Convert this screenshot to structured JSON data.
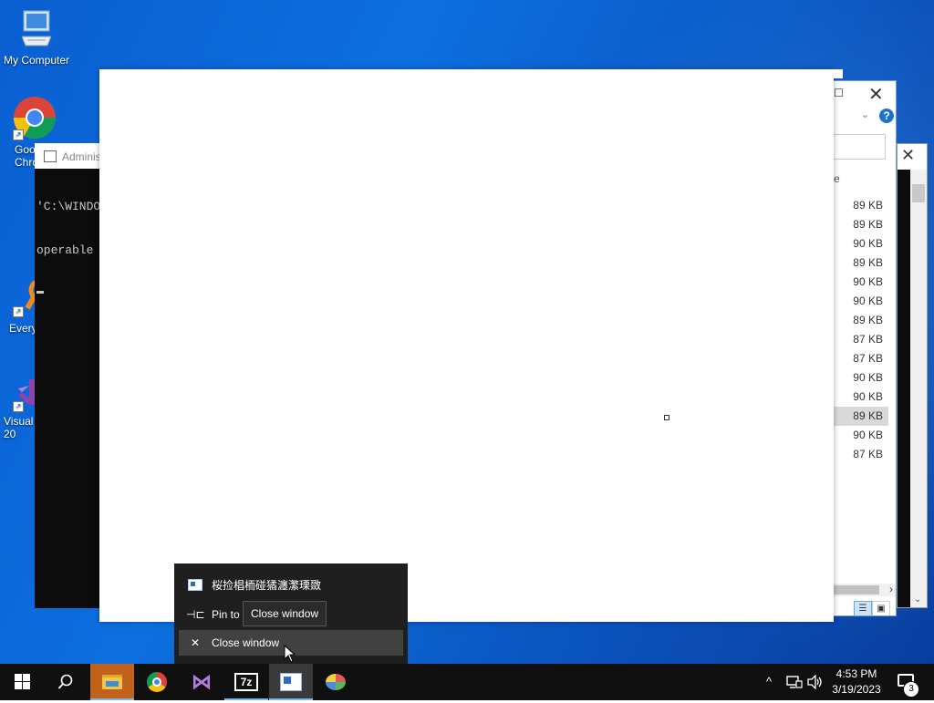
{
  "desktop": {
    "icons": [
      {
        "label": "My Computer",
        "icon": "computer-icon"
      },
      {
        "label": "Goo\nChro",
        "icon": "chrome-icon"
      },
      {
        "label": "Every",
        "icon": "everything-icon"
      },
      {
        "label": "Visual\n20",
        "icon": "visual-studio-icon"
      }
    ]
  },
  "console": {
    "title": "Adminis",
    "lines": [
      "'C:\\WINDO",
      "operable "
    ]
  },
  "explorer": {
    "title_max": "☐",
    "title_close": "✕",
    "column_header": "e",
    "sizes": [
      "89 KB",
      "89 KB",
      "90 KB",
      "89 KB",
      "90 KB",
      "90 KB",
      "89 KB",
      "87 KB",
      "87 KB",
      "90 KB",
      "90 KB",
      "89 KB",
      "90 KB",
      "87 KB"
    ],
    "selected_index": 11
  },
  "jumplist": {
    "app_name": "桜捡椙栭碰獝瀍瀿瑮敪",
    "pin_label": "Pin to",
    "close_label": "Close window",
    "tooltip": "Close window"
  },
  "taskbar": {
    "apps": [
      {
        "name": "file-explorer",
        "icon": "folder-icon"
      },
      {
        "name": "chrome",
        "icon": "chrome-icon"
      },
      {
        "name": "visual-studio",
        "icon": "visual-studio-icon"
      },
      {
        "name": "7zip",
        "icon": "7zip-icon",
        "label": "7z"
      },
      {
        "name": "app",
        "icon": "app-window-icon"
      },
      {
        "name": "paint",
        "icon": "paint-icon"
      }
    ],
    "time": "4:53 PM",
    "date": "3/19/2023",
    "notification_count": "3"
  }
}
